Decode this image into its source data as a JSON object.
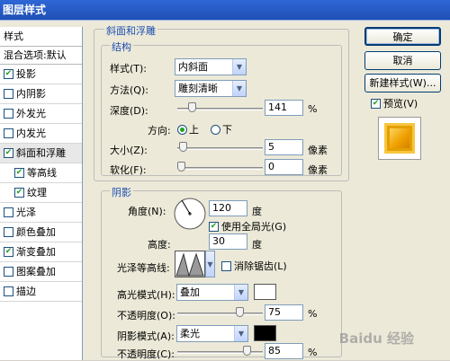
{
  "window": {
    "title": "图层样式"
  },
  "sidebar": {
    "header": "样式",
    "blend": "混合选项:默认",
    "items": [
      {
        "label": "投影",
        "checked": true
      },
      {
        "label": "内阴影",
        "checked": false
      },
      {
        "label": "外发光",
        "checked": false
      },
      {
        "label": "内发光",
        "checked": false
      },
      {
        "label": "斜面和浮雕",
        "checked": true,
        "selected": true
      },
      {
        "label": "等高线",
        "checked": true,
        "sub": true
      },
      {
        "label": "纹理",
        "checked": true,
        "sub": true
      },
      {
        "label": "光泽",
        "checked": false
      },
      {
        "label": "颜色叠加",
        "checked": false
      },
      {
        "label": "渐变叠加",
        "checked": true
      },
      {
        "label": "图案叠加",
        "checked": false
      },
      {
        "label": "描边",
        "checked": false
      }
    ]
  },
  "bevel": {
    "section": "斜面和浮雕",
    "structure": "结构",
    "style_label": "样式(T):",
    "style_value": "内斜面",
    "method_label": "方法(Q):",
    "method_value": "雕刻清晰",
    "depth_label": "深度(D):",
    "depth_value": "141",
    "depth_unit": "%",
    "depth_level": 0.14,
    "direction_label": "方向:",
    "dir_up": "上",
    "dir_down": "下",
    "size_label": "大小(Z):",
    "size_value": "5",
    "size_unit": "像素",
    "size_level": 0.02,
    "soften_label": "软化(F):",
    "soften_value": "0",
    "soften_unit": "像素",
    "soften_level": 0
  },
  "shading": {
    "section": "阴影",
    "angle_label": "角度(N):",
    "angle_value": "120",
    "angle_unit": "度",
    "global_light_label": "使用全局光(G)",
    "global_light": true,
    "altitude_label": "高度:",
    "altitude_value": "30",
    "altitude_unit": "度",
    "gloss_label": "光泽等高线:",
    "antialias_label": "消除锯齿(L)",
    "highlight_mode_label": "高光模式(H):",
    "highlight_mode_value": "叠加",
    "highlight_color": "#ffffff",
    "highlight_opacity_label": "不透明度(O):",
    "highlight_opacity_value": "75",
    "highlight_opacity_unit": "%",
    "highlight_level": 0.75,
    "shadow_mode_label": "阴影模式(A):",
    "shadow_mode_value": "柔光",
    "shadow_color": "#000000",
    "shadow_opacity_label": "不透明度(C):",
    "shadow_opacity_value": "85",
    "shadow_opacity_unit": "%",
    "shadow_level": 0.85
  },
  "buttons": {
    "ok": "确定",
    "cancel": "取消",
    "new_style": "新建样式(W)...",
    "preview": "预览(V)"
  },
  "watermark": "Baidu 经验"
}
